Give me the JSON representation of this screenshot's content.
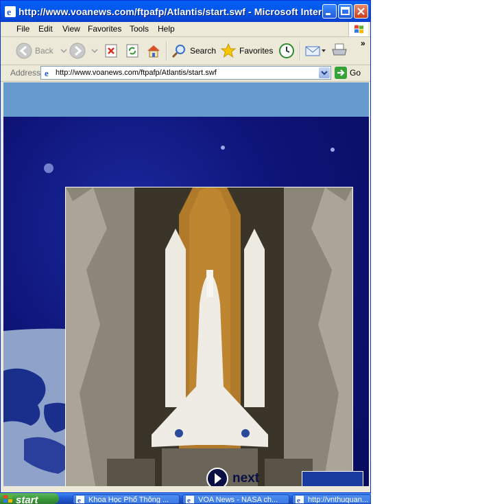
{
  "window": {
    "title": "http://www.voanews.com/ftpafp/Atlantis/start.swf - Microsoft Intern...",
    "controls": [
      "minimize",
      "maximize",
      "close"
    ]
  },
  "menu": {
    "items": [
      {
        "label": "File"
      },
      {
        "label": "Edit"
      },
      {
        "label": "View"
      },
      {
        "label": "Favorites"
      },
      {
        "label": "Tools"
      },
      {
        "label": "Help"
      }
    ]
  },
  "toolbar": {
    "back_label": "Back",
    "search_label": "Search",
    "favorites_label": "Favorites",
    "overflow": "»"
  },
  "address": {
    "label": "Address",
    "url": "http://www.voanews.com/ftpafp/Atlantis/start.swf",
    "go_label": "Go"
  },
  "content": {
    "next_label": "next"
  },
  "taskbar": {
    "start_label": "start",
    "tasks": [
      {
        "label": "Khoa Học Phổ Thông ..."
      },
      {
        "label": "VOA News - NASA ch..."
      },
      {
        "label": "http://vnthuquan..."
      }
    ]
  },
  "colors": {
    "titlebar": "#0058EE",
    "chrome": "#ECE9D8",
    "flash_top_band": "#6699CC",
    "flash_background": "#0B0E6A"
  },
  "icons": [
    "ie-icon",
    "back-icon",
    "forward-icon",
    "stop-icon",
    "refresh-icon",
    "home-icon",
    "search-icon",
    "favorites-star-icon",
    "history-icon",
    "mail-icon",
    "print-icon",
    "windows-logo-icon",
    "go-arrow-icon",
    "next-arrow-icon"
  ]
}
